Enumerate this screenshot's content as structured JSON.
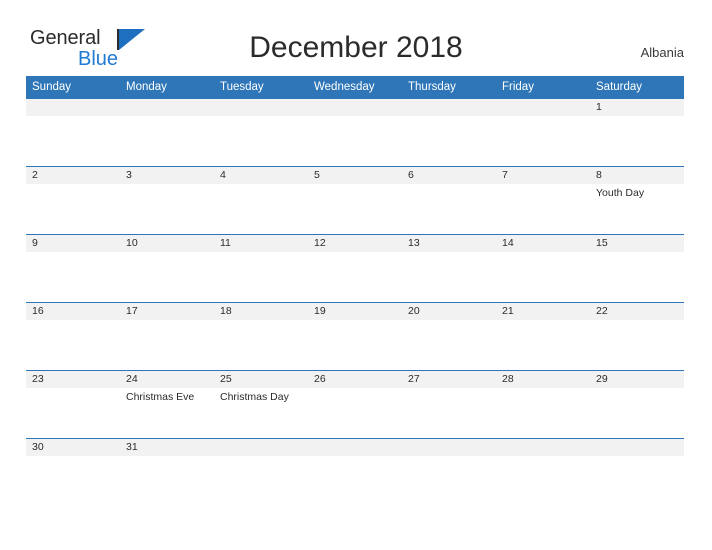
{
  "brand": {
    "name_part1": "General",
    "name_part2": "Blue",
    "flag_icon": "blue-flag-icon"
  },
  "header": {
    "title": "December 2018",
    "country": "Albania"
  },
  "colors": {
    "header_blue": "#2e76b8",
    "brand_blue": "#1f7ad4",
    "day_band_gray": "#f2f2f2",
    "text_dark": "#2b2b2b"
  },
  "calendar": {
    "month": "December",
    "year": "2018",
    "weekday_headers": [
      "Sunday",
      "Monday",
      "Tuesday",
      "Wednesday",
      "Thursday",
      "Friday",
      "Saturday"
    ],
    "weeks": [
      [
        {
          "day": "",
          "event": ""
        },
        {
          "day": "",
          "event": ""
        },
        {
          "day": "",
          "event": ""
        },
        {
          "day": "",
          "event": ""
        },
        {
          "day": "",
          "event": ""
        },
        {
          "day": "",
          "event": ""
        },
        {
          "day": "1",
          "event": ""
        }
      ],
      [
        {
          "day": "2",
          "event": ""
        },
        {
          "day": "3",
          "event": ""
        },
        {
          "day": "4",
          "event": ""
        },
        {
          "day": "5",
          "event": ""
        },
        {
          "day": "6",
          "event": ""
        },
        {
          "day": "7",
          "event": ""
        },
        {
          "day": "8",
          "event": "Youth Day"
        }
      ],
      [
        {
          "day": "9",
          "event": ""
        },
        {
          "day": "10",
          "event": ""
        },
        {
          "day": "11",
          "event": ""
        },
        {
          "day": "12",
          "event": ""
        },
        {
          "day": "13",
          "event": ""
        },
        {
          "day": "14",
          "event": ""
        },
        {
          "day": "15",
          "event": ""
        }
      ],
      [
        {
          "day": "16",
          "event": ""
        },
        {
          "day": "17",
          "event": ""
        },
        {
          "day": "18",
          "event": ""
        },
        {
          "day": "19",
          "event": ""
        },
        {
          "day": "20",
          "event": ""
        },
        {
          "day": "21",
          "event": ""
        },
        {
          "day": "22",
          "event": ""
        }
      ],
      [
        {
          "day": "23",
          "event": ""
        },
        {
          "day": "24",
          "event": "Christmas Eve"
        },
        {
          "day": "25",
          "event": "Christmas Day"
        },
        {
          "day": "26",
          "event": ""
        },
        {
          "day": "27",
          "event": ""
        },
        {
          "day": "28",
          "event": ""
        },
        {
          "day": "29",
          "event": ""
        }
      ],
      [
        {
          "day": "30",
          "event": ""
        },
        {
          "day": "31",
          "event": ""
        },
        {
          "day": "",
          "event": ""
        },
        {
          "day": "",
          "event": ""
        },
        {
          "day": "",
          "event": ""
        },
        {
          "day": "",
          "event": ""
        },
        {
          "day": "",
          "event": ""
        }
      ]
    ]
  }
}
